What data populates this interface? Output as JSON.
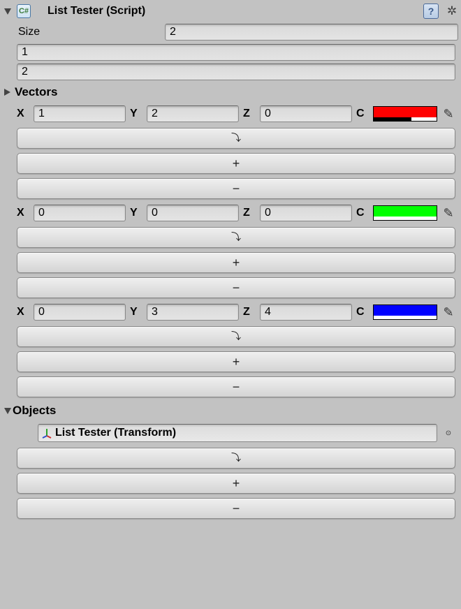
{
  "header": {
    "title": "List Tester (Script)"
  },
  "size": {
    "label": "Size",
    "value": "2"
  },
  "list": [
    "1",
    "2"
  ],
  "vectorsHeading": "Vectors",
  "labels": {
    "x": "X",
    "y": "Y",
    "z": "Z",
    "c": "C"
  },
  "buttons": {
    "dup": "⤵",
    "add": "+",
    "remove": "−"
  },
  "vectors": [
    {
      "x": "1",
      "y": "2",
      "z": "0",
      "color": "#ff0000",
      "alphaBar": "60%"
    },
    {
      "x": "0",
      "y": "0",
      "z": "0",
      "color": "#00ff00",
      "alphaBar": "0%"
    },
    {
      "x": "0",
      "y": "3",
      "z": "4",
      "color": "#0000ff",
      "alphaBar": "0%"
    }
  ],
  "objectsHeading": "Objects",
  "objects": [
    {
      "label": "List Tester (Transform)"
    }
  ]
}
